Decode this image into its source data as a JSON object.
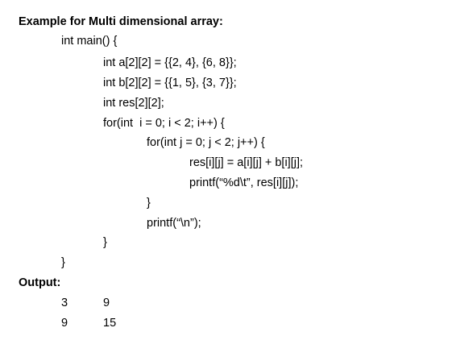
{
  "heading": "Example for Multi dimensional array:",
  "code": {
    "main_open": "int main() {",
    "decl_a": "int a[2][2] = {{2, 4}, {6, 8}};",
    "decl_b": "int b[2][2] = {{1, 5}, {3, 7}};",
    "decl_res": "int res[2][2];",
    "for_outer": "for(int  i = 0; i < 2; i++) {",
    "for_inner": "for(int j = 0; j < 2; j++) {",
    "assign": "res[i][j] = a[i][j] + b[i][j];",
    "printf_val": "printf(“%d\\t”, res[i][j]);",
    "close_inner": "}",
    "printf_newline": "printf(“\\n”);",
    "close_outer": "}",
    "close_main": "}"
  },
  "output_heading": "Output:",
  "output": {
    "rows": [
      [
        "3",
        "9"
      ],
      [
        "9",
        "15"
      ]
    ]
  }
}
